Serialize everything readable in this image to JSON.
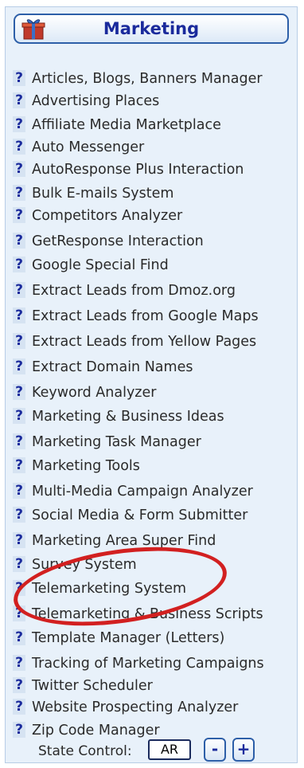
{
  "header": {
    "title": "Marketing",
    "icon": "gift-box-icon"
  },
  "help_glyph": "?",
  "items": [
    "Articles, Blogs, Banners Manager",
    "Advertising Places",
    "Affiliate Media Marketplace",
    "Auto Messenger",
    "AutoResponse Plus Interaction",
    "Bulk E-mails System",
    "Competitors Analyzer",
    "GetResponse Interaction",
    "Google Special Find",
    "Extract Leads from Dmoz.org",
    "Extract Leads from Google Maps",
    "Extract Leads from Yellow Pages",
    "Extract Domain Names",
    "Keyword Analyzer",
    "Marketing & Business Ideas",
    "Marketing Task Manager",
    "Marketing Tools",
    "Multi-Media Campaign Analyzer",
    "Social Media & Form Submitter",
    "Marketing Area Super Find",
    "Survey System",
    "Telemarketing System",
    "Telemarketing & Business Scripts",
    "Template Manager (Letters)",
    "Tracking of Marketing Campaigns",
    "Twitter Scheduler",
    "Website Prospecting Analyzer",
    "Zip Code Manager"
  ],
  "state_control": {
    "label": "State Control:",
    "value": "AR",
    "minus": "-",
    "plus": "+"
  },
  "colors": {
    "accent": "#1a2a9c",
    "highlight_circle": "#d22020",
    "panel_bg": "#e8f1fa"
  }
}
